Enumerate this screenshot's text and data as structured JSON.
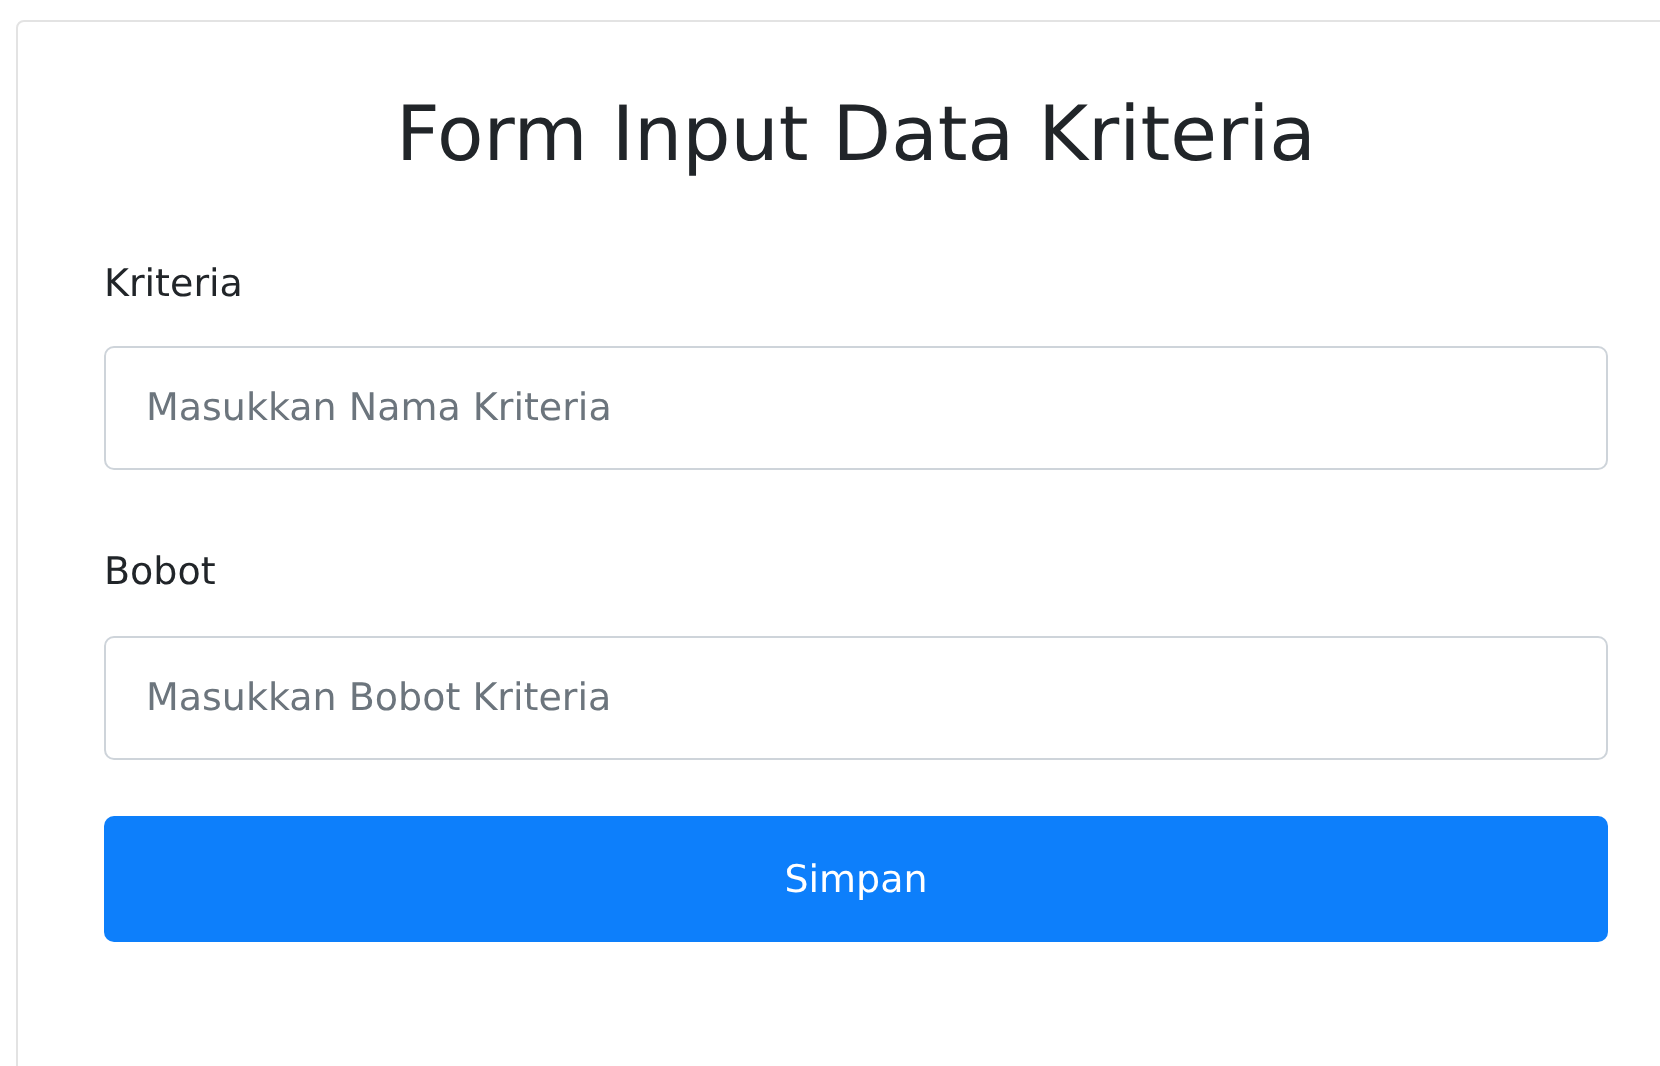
{
  "title": "Form Input Data Kriteria",
  "fields": [
    {
      "label": "Kriteria",
      "placeholder": "Masukkan Nama Kriteria"
    },
    {
      "label": "Bobot",
      "placeholder": "Masukkan Bobot Kriteria"
    }
  ],
  "button": "Simpan"
}
